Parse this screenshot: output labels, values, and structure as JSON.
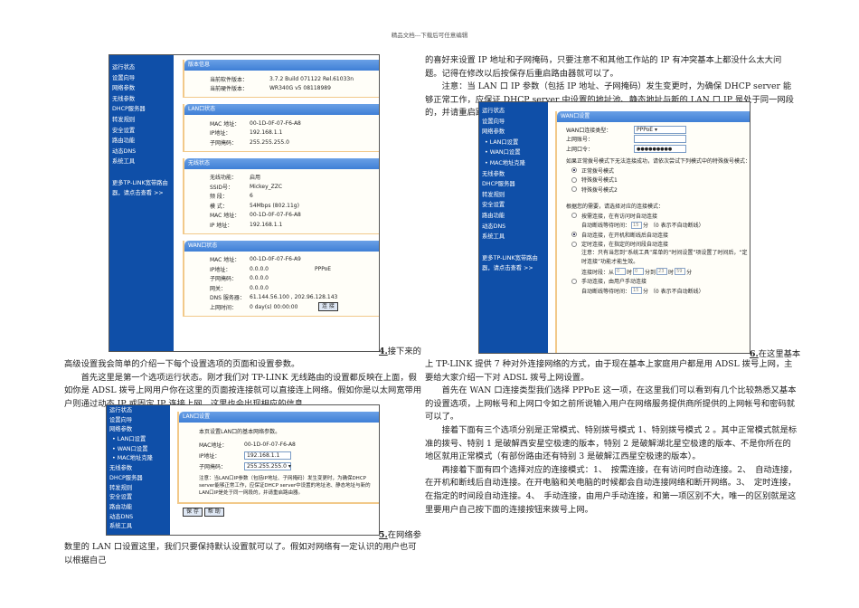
{
  "header": "精品文档---下载后可任意编辑",
  "shot1": {
    "sidebar": [
      "运行状态",
      "设置向导",
      "网络参数",
      "无线参数",
      "DHCP服务器",
      "转发规则",
      "安全设置",
      "路由功能",
      "动态DNS",
      "系统工具"
    ],
    "promo1": "更多TP-LINK宽带路由",
    "promo2": "器，请点击查看 >>",
    "version": {
      "title": "版本信息",
      "sw_label": "当前软件版本：",
      "sw": "3.7.2 Build 071122 Rel.61033n",
      "hw_label": "当前硬件版本：",
      "hw": "WR340G v5 08118989"
    },
    "lan": {
      "title": "LAN口状态",
      "mac_label": "MAC 地址：",
      "mac": "00-1D-0F-07-F6-A8",
      "ip_label": "IP地址：",
      "ip": "192.168.1.1",
      "mask_label": "子网掩码：",
      "mask": "255.255.255.0"
    },
    "wireless": {
      "title": "无线状态",
      "func_label": "无线功能：",
      "func": "启用",
      "ssid_label": "SSID号：",
      "ssid": "Mickey_ZZC",
      "ch_label": "频 段：",
      "ch": "6",
      "mode_label": "模 式：",
      "mode": "54Mbps (802.11g)",
      "mac_label": "MAC 地址：",
      "mac": "00-1D-0F-07-F6-A8",
      "ip_label": "IP 地址：",
      "ip": "192.168.1.1"
    },
    "wan": {
      "title": "WAN口状态",
      "mac_label": "MAC 地址：",
      "mac": "00-1D-0F-07-F6-A9",
      "ip_label": "IP地址：",
      "ip": "0.0.0.0",
      "type": "PPPoE",
      "mask_label": "子网掩码：",
      "mask": "0.0.0.0",
      "gw_label": "网关：",
      "gw": "0.0.0.0",
      "dns_label": "DNS 服务器：",
      "dns": "61.144.56.100 , 202.96.128.143",
      "time_label": "上网时间：",
      "time": "0 day(s) 00:00:00",
      "connect": "连 接"
    },
    "caption_num": "4.",
    "caption": "接下来的"
  },
  "left_text": [
    "高级设置我会简单的介绍一下每个设置选项的页面和设置参数。",
    "首先这里是第一个选项运行状态。刚才我们对 TP-LINK 无线路由的设置都反映在上面，假如你是 ADSL 拨号上网用户你在这里的页面按连接就可以直接连上网络。假如你是以太网宽带用户则通过动态 IP 或固定 IP 连接上网，这里也会出现相应的信息。"
  ],
  "shot2": {
    "sidebar": [
      "运行状态",
      "设置向导",
      "网络参数",
      "• LAN口设置",
      "• WAN口设置",
      "• MAC地址克隆",
      "无线参数",
      "DHCP服务器",
      "转发规则",
      "安全设置",
      "路由功能",
      "动态DNS",
      "系统工具"
    ],
    "title": "LAN口设置",
    "intro": "本页设置LAN口的基本网络参数。",
    "mac_label": "MAC地址：",
    "mac": "00-1D-0F-07-F6-A8",
    "ip_label": "IP地址：",
    "ip": "192.168.1.1",
    "mask_label": "子网掩码：",
    "mask": "255.255.255.0",
    "note": "注意：当LAN口IP参数（包括IP地址、子网掩码）发生变更时，为确保DHCP server能够正常工作，应保证DHCP server中设置的地址池、静态地址与新的LAN口IP是处于同一网段的，并请重启路由器。",
    "save": "保 存",
    "help": "帮 助",
    "caption_num": "5.",
    "caption": "在网络参"
  },
  "left_text2": "数里的 LAN 口设置这里，我们只要保持默认设置就可以了。假如对网络有一定认识的用户也可以根据自己",
  "right_text": [
    "的喜好来设置 IP 地址和子网掩码，只要注意不和其他工作站的 IP 有冲突基本上都没什么太大问题。记得在修改以后按保存后重启路由器就可以了。",
    "注意：当 LAN 口 IP 参数（包括 IP 地址、子网掩码）发生变更时，为确保 DHCP server 能够正常工作，应保证 DHCP server 中设置的地址池、静态地址与新的 LAN 口 IP 是处于同一网段的，并请重启路由器。"
  ],
  "shot3": {
    "sidebar": [
      "运行状态",
      "设置向导",
      "网络参数",
      "• LAN口设置",
      "• WAN口设置",
      "• MAC地址克隆",
      "无线参数",
      "DHCP服务器",
      "转发规则",
      "安全设置",
      "路由功能",
      "动态DNS",
      "系统工具"
    ],
    "promo1": "更多TP-LINK宽带路由",
    "promo2": "器，请点击查看 >>",
    "title": "WAN口设置",
    "type_label": "WAN口连接类型：",
    "type": "PPPoE",
    "user_label": "上网账号：",
    "user": "",
    "pass_label": "上网口令：",
    "pass": "●●●●●●●●●",
    "hint": "如果正常拨号模式下无法连接成功，请依次尝试下列模式中的特殊拨号模式：",
    "dial": [
      "正常拨号模式",
      "特殊拨号模式1",
      "特殊拨号模式2"
    ],
    "mode_hint": "根据您的需要，请选择对应的连接模式：",
    "m1": "按需连接，在有访问时自动连接",
    "idle_label": "自动断线等待时间：",
    "idle": "15",
    "idle_unit": "分 （0 表示不自动断线）",
    "m2": "自动连接，在开机和断线后自动连接",
    "m3": "定时连接，在指定的时间段自动连接",
    "m3_note": "注意：只有当您到“系统工具”菜单的“时间设置”项设置了时间后，“定时连接”功能才能生效。",
    "period_label": "连接时段：从",
    "h1": "0",
    "t1": "时",
    "m1v": "0",
    "t2": "分到",
    "h2": "23",
    "t3": "时",
    "m2v": "59",
    "t4": "分",
    "m4": "手动连接，由用户手动连接",
    "idle2": "15",
    "caption_num": "6.",
    "caption": "在这里基本"
  },
  "right_text2": [
    "上 TP-LINK 提供 7 种对外连接网络的方式，由于现在基本上家庭用户都是用 ADSL 拨号上网，主要给大家介绍一下对 ADSL 拨号上网设置。",
    "首先在 WAN 口连接类型我们选择 PPPoE 这一项，在这里我们可以看到有几个比较熟悉又基本的设置选项，上网帐号和上网口令如之前所说输入用户在网络服务提供商所提供的上网帐号和密码就可以了。",
    "接着下面有三个选项分别是正常模式、特别拨号模式 1、特别拨号模式 2 。其中正常模式就是标准的拨号、特别 1 是破解西安星空极速的版本，特别 2 是破解湖北星空极速的版本、不是你所在的地区就用正常模式（有部份路由还有特别 3 是破解江西星空极速的版本）。",
    "再接着下面有四个选择对应的连接模式：1、　按需连接，在有访问时自动连接。2、　自动连接，在开机和断线后自动连接。在开电脑和关电脑的时候都会自动连接网络和断开网络。3、　定时连接，在指定的时间段自动连接。4、　手动连接，由用户手动连接，和第一项区别不大，唯一的区别就是这里要用户自己按下面的连接按钮来拨号上网。"
  ]
}
